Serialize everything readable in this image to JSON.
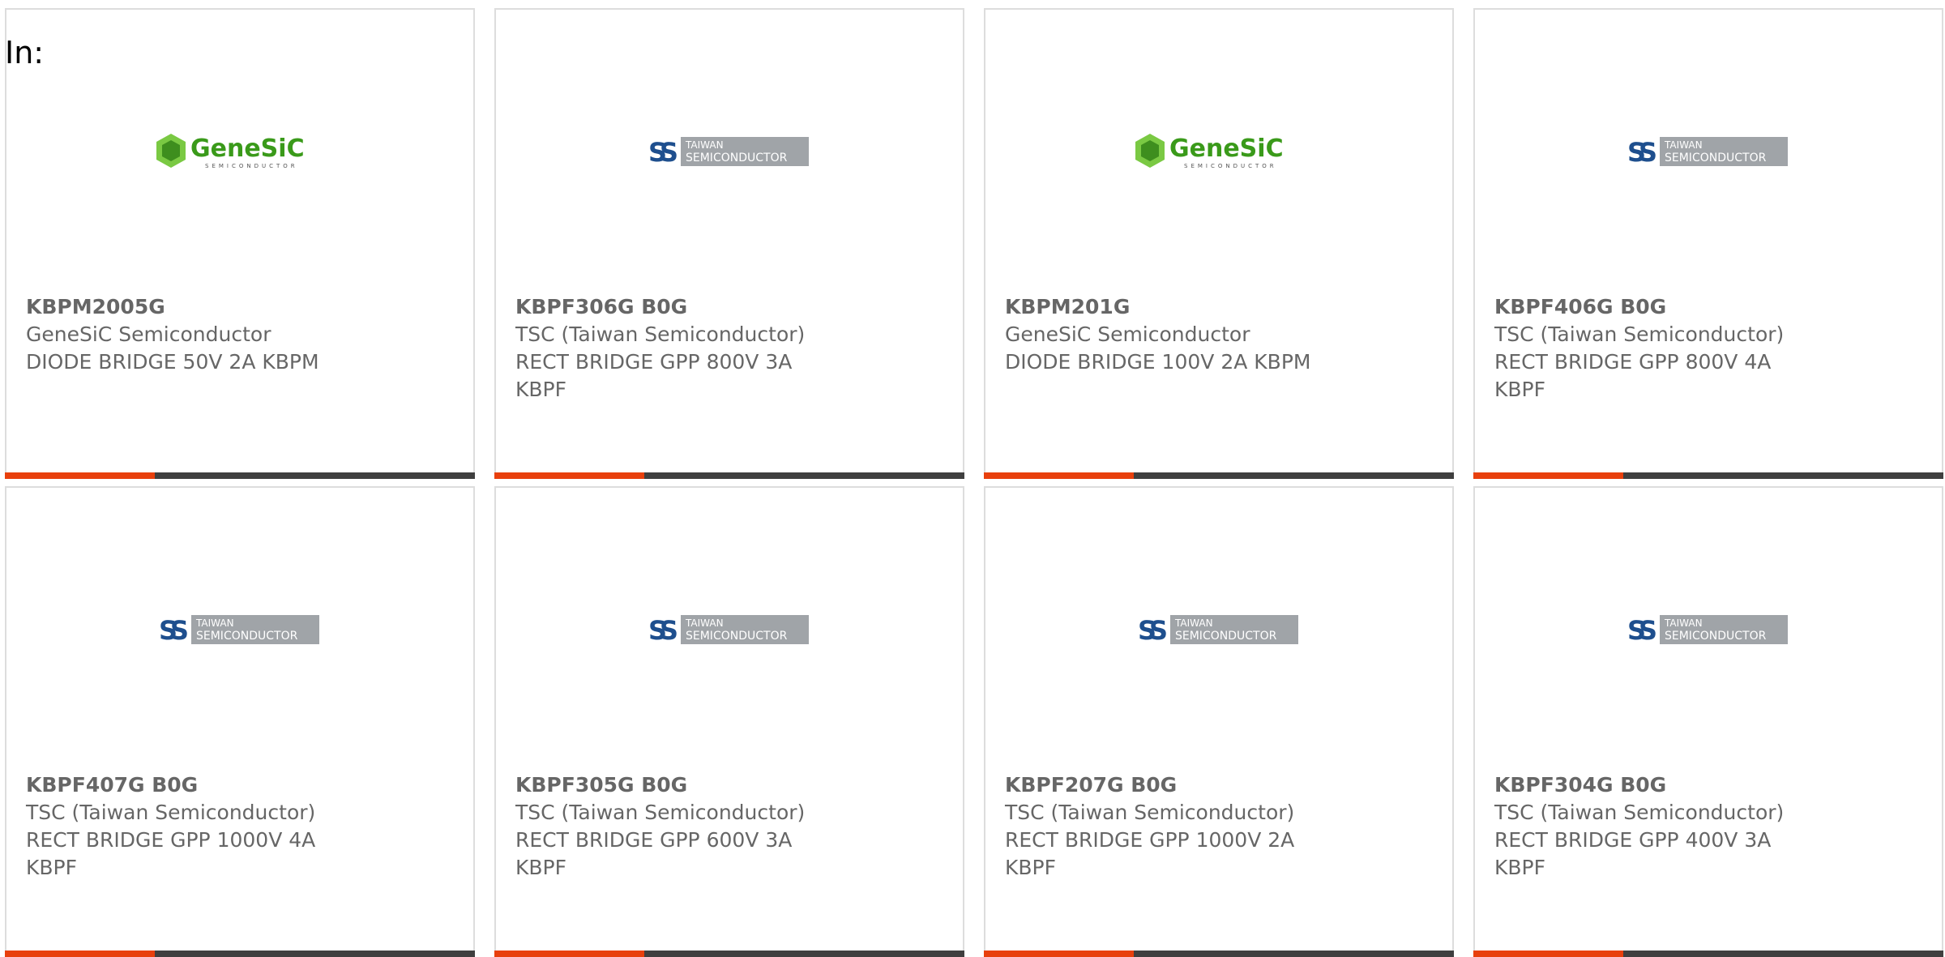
{
  "filter": {
    "label": "In:"
  },
  "theme": {
    "accent": "#e8400d",
    "bar": "#3f3f3f",
    "border": "#dddddd"
  },
  "products": [
    {
      "part": "KBPM2005G",
      "manufacturer": "GeneSiC Semiconductor",
      "description": "DIODE BRIDGE 50V 2A KBPM",
      "logo": "genesic-logo",
      "logo_word": "GeneSiC",
      "logo_sub": "SEMICONDUCTOR"
    },
    {
      "part": "KBPF306G B0G",
      "manufacturer": "TSC (Taiwan Semiconductor)",
      "description": "RECT BRIDGE GPP 800V 3A KBPF",
      "logo": "tsc-logo",
      "logo_line1": "TAIWAN",
      "logo_line2": "SEMICONDUCTOR"
    },
    {
      "part": "KBPM201G",
      "manufacturer": "GeneSiC Semiconductor",
      "description": "DIODE BRIDGE 100V 2A KBPM",
      "logo": "genesic-logo",
      "logo_word": "GeneSiC",
      "logo_sub": "SEMICONDUCTOR"
    },
    {
      "part": "KBPF406G B0G",
      "manufacturer": "TSC (Taiwan Semiconductor)",
      "description": "RECT BRIDGE GPP 800V 4A KBPF",
      "logo": "tsc-logo",
      "logo_line1": "TAIWAN",
      "logo_line2": "SEMICONDUCTOR"
    },
    {
      "part": "KBPF407G B0G",
      "manufacturer": "TSC (Taiwan Semiconductor)",
      "description": "RECT BRIDGE GPP 1000V 4A KBPF",
      "logo": "tsc-logo",
      "logo_line1": "TAIWAN",
      "logo_line2": "SEMICONDUCTOR"
    },
    {
      "part": "KBPF305G B0G",
      "manufacturer": "TSC (Taiwan Semiconductor)",
      "description": "RECT BRIDGE GPP 600V 3A KBPF",
      "logo": "tsc-logo",
      "logo_line1": "TAIWAN",
      "logo_line2": "SEMICONDUCTOR"
    },
    {
      "part": "KBPF207G B0G",
      "manufacturer": "TSC (Taiwan Semiconductor)",
      "description": "RECT BRIDGE GPP 1000V 2A KBPF",
      "logo": "tsc-logo",
      "logo_line1": "TAIWAN",
      "logo_line2": "SEMICONDUCTOR"
    },
    {
      "part": "KBPF304G B0G",
      "manufacturer": "TSC (Taiwan Semiconductor)",
      "description": "RECT BRIDGE GPP 400V 3A KBPF",
      "logo": "tsc-logo",
      "logo_line1": "TAIWAN",
      "logo_line2": "SEMICONDUCTOR"
    }
  ]
}
